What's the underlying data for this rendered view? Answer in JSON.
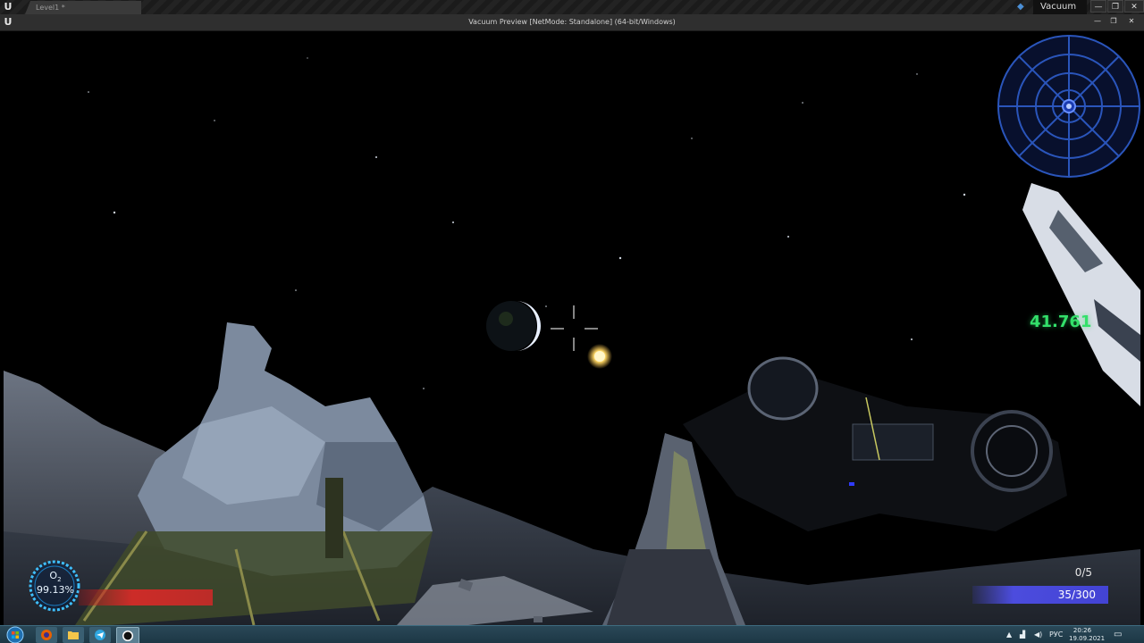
{
  "editor": {
    "logo": "U",
    "level_tab": "Level1 *",
    "project_label": "Vacuum",
    "window_controls": [
      "—",
      "❐",
      "✕"
    ]
  },
  "preview": {
    "title": "Vacuum Preview [NetMode: Standalone]  (64-bit/Windows)",
    "window_controls": [
      "—",
      "❐",
      "✕"
    ]
  },
  "hud": {
    "timer": "41.761",
    "o2_label": "O",
    "o2_sub": "2",
    "o2_value": "99.13%",
    "o2_level": 0.9913,
    "health_color": "#e02828",
    "items_counter": "0/5",
    "ammo": "35/300",
    "ammo_color": "#5050f0",
    "timer_color": "#33e06a",
    "radar_color": "#2f5fd0"
  },
  "taskbar": {
    "apps": [
      "firefox-icon",
      "folder-icon",
      "telegram-icon",
      "unreal-icon"
    ],
    "tray_lang": "РУС",
    "time": "20:26",
    "date": "19.09.2021"
  }
}
